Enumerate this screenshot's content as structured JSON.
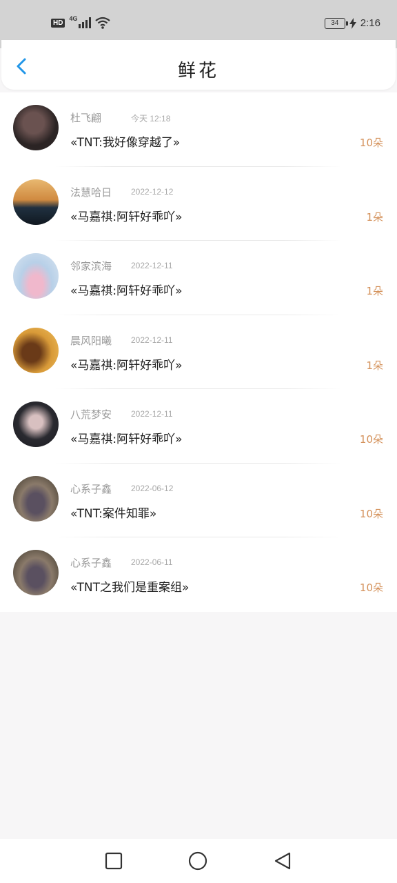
{
  "status_bar": {
    "hd": "HD",
    "network": "4G",
    "battery": "34",
    "time": "2:16"
  },
  "header": {
    "title": "鲜花"
  },
  "gifts": [
    {
      "name": "杜飞翩",
      "date": "今天 12:18",
      "work": "«TNT:我好像穿越了»",
      "count": "10朵",
      "avatar_colors": [
        "#2b2424",
        "#6a5250"
      ]
    },
    {
      "name": "法慧哈日",
      "date": "2022-12-12",
      "work": "«马嘉祺:阿轩好乖吖»",
      "count": "1朵",
      "avatar_colors": [
        "#e2a860",
        "#203040"
      ]
    },
    {
      "name": "邻家滨海",
      "date": "2022-12-11",
      "work": "«马嘉祺:阿轩好乖吖»",
      "count": "1朵",
      "avatar_colors": [
        "#b8d0e8",
        "#e8a8c0"
      ]
    },
    {
      "name": "晨风阳曦",
      "date": "2022-12-11",
      "work": "«马嘉祺:阿轩好乖吖»",
      "count": "1朵",
      "avatar_colors": [
        "#e0a840",
        "#5a3010"
      ]
    },
    {
      "name": "八荒梦安",
      "date": "2022-12-11",
      "work": "«马嘉祺:阿轩好乖吖»",
      "count": "10朵",
      "avatar_colors": [
        "#2a2a30",
        "#c8b0b0"
      ]
    },
    {
      "name": "心系子鑫",
      "date": "2022-06-12",
      "work": "«TNT:案件知罪»",
      "count": "10朵",
      "avatar_colors": [
        "#4a4030",
        "#8a7a6a"
      ]
    },
    {
      "name": "心系子鑫",
      "date": "2022-06-11",
      "work": "«TNT之我们是重案组»",
      "count": "10朵",
      "avatar_colors": [
        "#4a4030",
        "#8a7a6a"
      ]
    }
  ],
  "colors": {
    "accent": "#2196e8",
    "count": "#d4915a"
  },
  "nav": {
    "recent_icon": "square-icon",
    "home_icon": "circle-icon",
    "back_icon": "triangle-back-icon"
  }
}
